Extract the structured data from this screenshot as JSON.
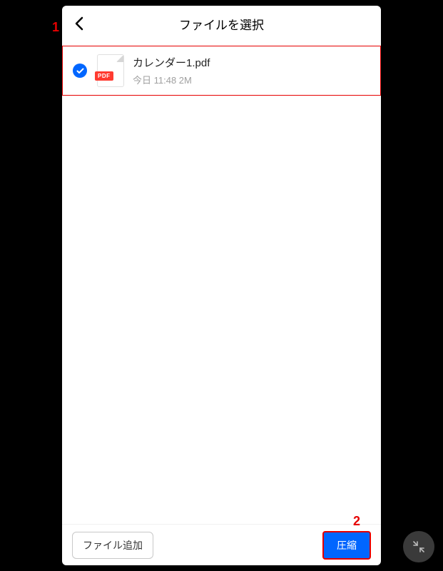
{
  "header": {
    "title": "ファイルを選択"
  },
  "callouts": {
    "one": "1",
    "two": "2"
  },
  "file": {
    "name": "カレンダー1.pdf",
    "detail": "今日 11:48 2M",
    "badge": "PDF"
  },
  "footer": {
    "add_label": "ファイル追加",
    "compress_label": "圧縮"
  }
}
